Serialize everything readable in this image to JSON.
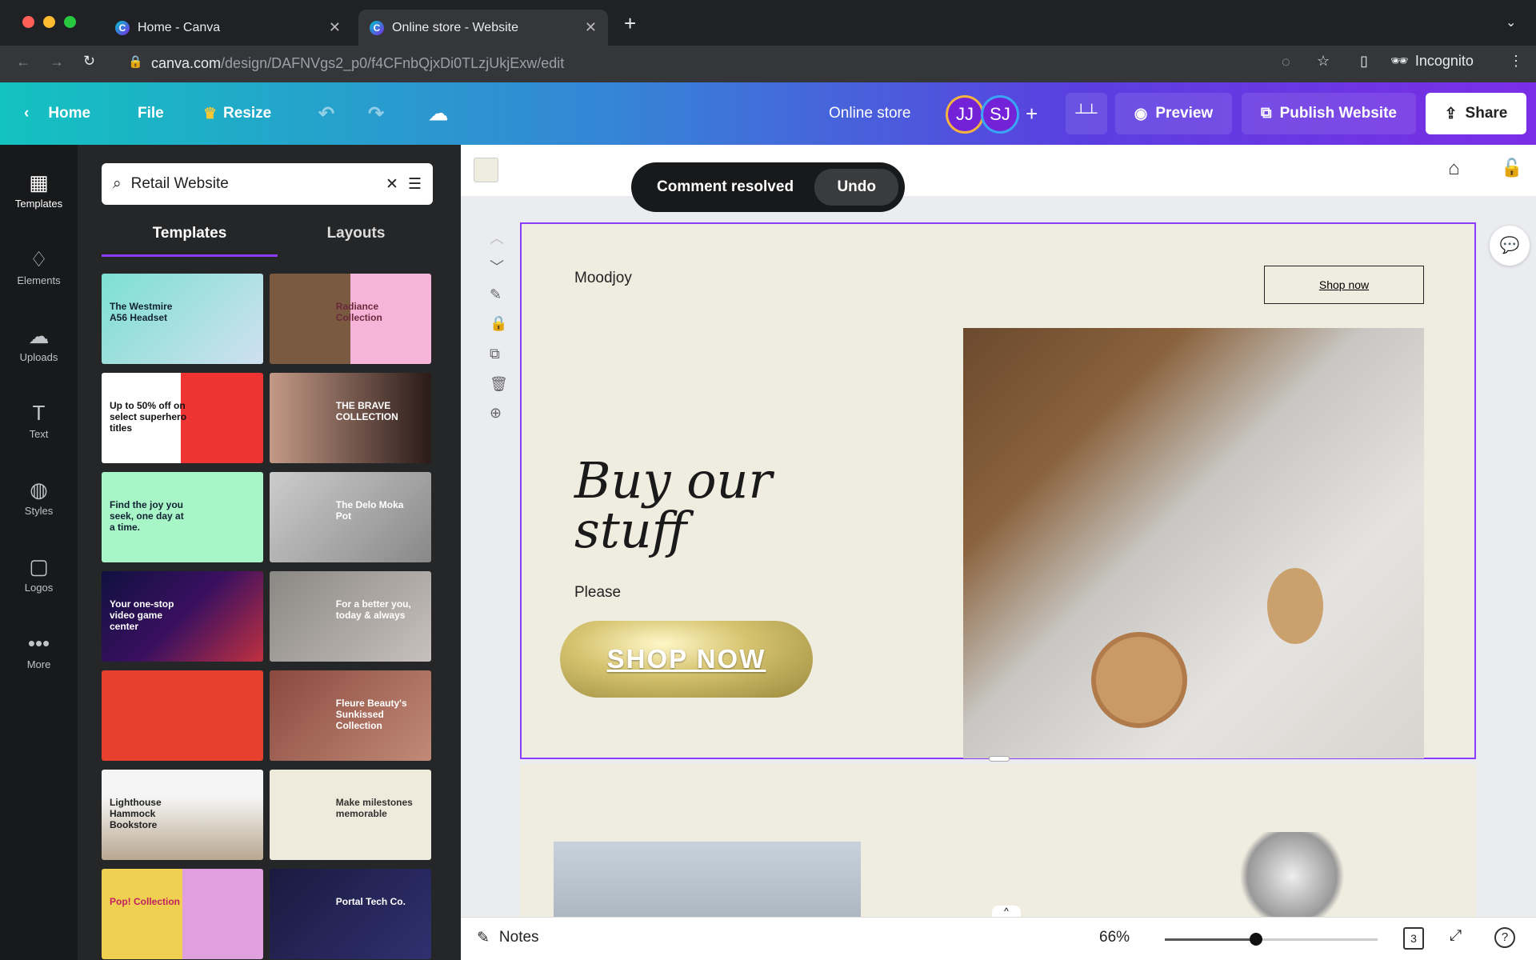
{
  "browser": {
    "tabs": [
      {
        "title": "Home - Canva"
      },
      {
        "title": "Online store - Website"
      }
    ],
    "url_domain": "canva.com",
    "url_path": "/design/DAFNVgs2_p0/f4CFnbQjxDi0TLzjUkjExw/edit",
    "profile": "Incognito"
  },
  "toolbar": {
    "home": "Home",
    "file": "File",
    "resize": "Resize",
    "design_title": "Online store",
    "avatars": [
      "JJ",
      "SJ"
    ],
    "preview": "Preview",
    "publish": "Publish Website",
    "share": "Share"
  },
  "rail": {
    "items": [
      {
        "label": "Templates"
      },
      {
        "label": "Elements"
      },
      {
        "label": "Uploads"
      },
      {
        "label": "Text"
      },
      {
        "label": "Styles"
      },
      {
        "label": "Logos"
      },
      {
        "label": "More"
      }
    ]
  },
  "panel": {
    "search_value": "Retail Website",
    "tabs": [
      {
        "label": "Templates"
      },
      {
        "label": "Layouts"
      }
    ],
    "templates": [
      {
        "text": "The Westmire A56 Headset"
      },
      {
        "text": "Radiance Collection"
      },
      {
        "text": "Up to 50% off on select superhero titles"
      },
      {
        "text": "THE BRAVE COLLECTION"
      },
      {
        "text": "Find the joy you seek, one day at a time."
      },
      {
        "text": "The Delo Moka Pot"
      },
      {
        "text": "Your one-stop video game center"
      },
      {
        "text": "For a better you, today & always"
      },
      {
        "text": ""
      },
      {
        "text": "Fleure Beauty's Sunkissed Collection"
      },
      {
        "text": "Lighthouse Hammock Bookstore"
      },
      {
        "text": "Make milestones memorable"
      },
      {
        "text": "Pop! Collection"
      },
      {
        "text": "Portal Tech Co."
      }
    ]
  },
  "toast": {
    "message": "Comment resolved",
    "action": "Undo"
  },
  "page": {
    "brand": "Moodjoy",
    "nav_button": "Shop now",
    "headline": "Buy our stuff",
    "subtext": "Please",
    "cta": "SHOP NOW"
  },
  "bottom": {
    "notes": "Notes",
    "zoom": "66%",
    "zoom_fraction": 0.66,
    "page_count": "3"
  },
  "colors": {
    "accent": "#8b3dff",
    "toolbar_start": "#13c2c0",
    "toolbar_end": "#7a2ee6"
  }
}
